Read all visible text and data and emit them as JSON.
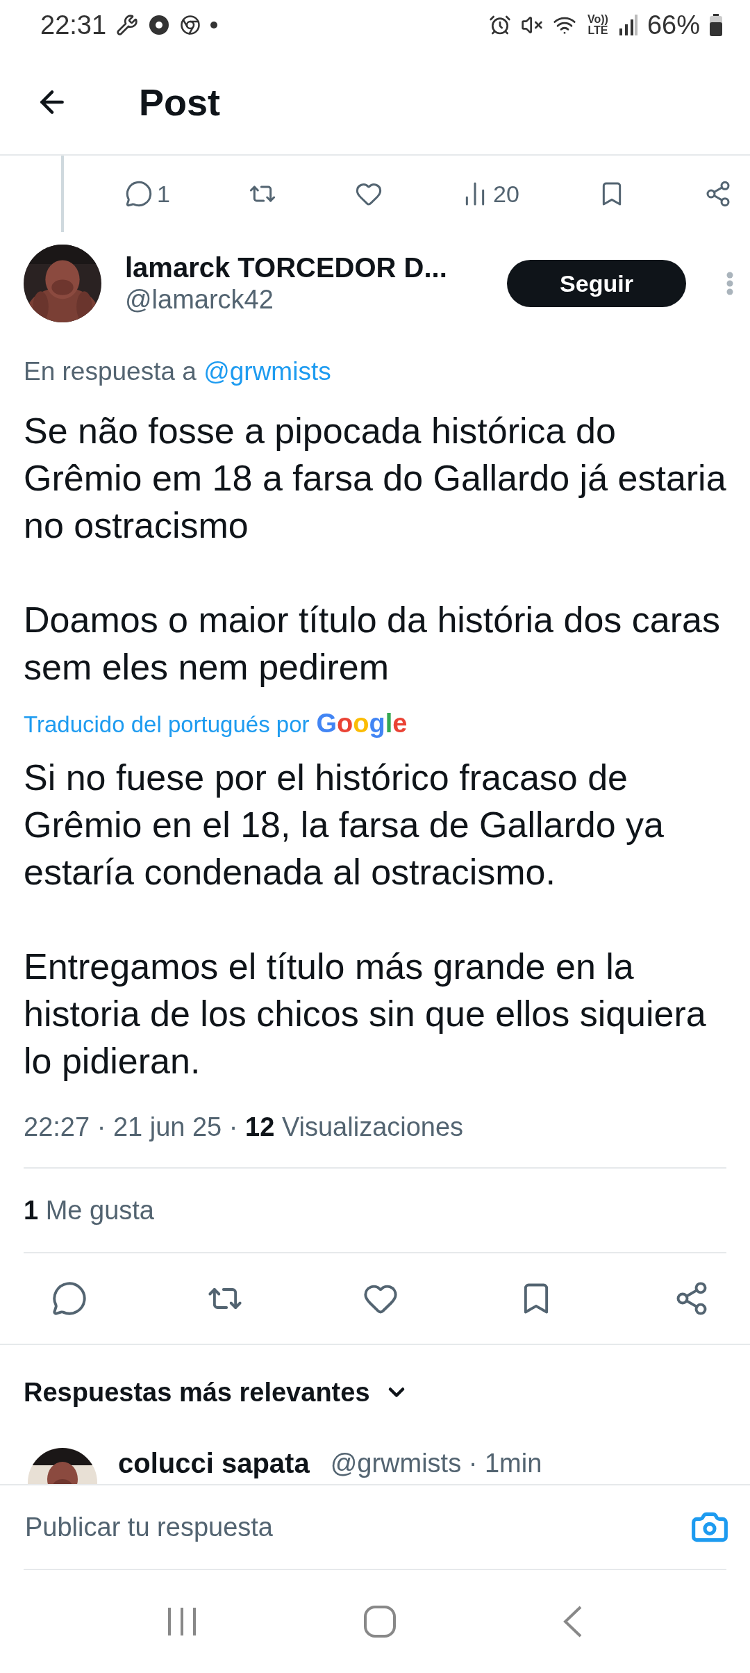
{
  "status_bar": {
    "time": "22:31",
    "network": "Vo)) LTE",
    "battery": "66%"
  },
  "header": {
    "title": "Post"
  },
  "previous_post": {
    "actions": [
      {
        "kind": "reply",
        "count": "1"
      },
      {
        "kind": "repost"
      },
      {
        "kind": "like"
      },
      {
        "kind": "views",
        "count": "20"
      },
      {
        "kind": "bookmark"
      },
      {
        "kind": "share"
      }
    ]
  },
  "post": {
    "author": "lamarck TORCEDOR D...",
    "handle": "@lamarck42",
    "follow_button": "Seguir",
    "reply_to": {
      "prefix": "En respuesta a",
      "mention": "@grwmists"
    },
    "body": [
      "Se não fosse a pipocada histórica do Grêmio em 18 a farsa do Gallardo já estaria no ostracismo",
      "Doamos o maior título da história dos caras sem eles nem pedirem"
    ],
    "translation": {
      "label": "Traducido del portugués por",
      "provider": "Google"
    },
    "translated_body": [
      "Si no fuese por el histórico fracaso de Grêmio en el 18, la farsa de Gallardo ya estaría condenada al ostracismo.",
      "Entregamos el título más grande en la historia de los chicos sin que ellos siquiera lo pidieran."
    ],
    "meta": {
      "time": "22:27",
      "separator": "·",
      "date": "21 jun 25",
      "views_count": "12",
      "views_label": "Visualizaciones"
    },
    "likes": {
      "count": "1",
      "label": "Me gusta"
    },
    "actions": [
      {
        "kind": "reply"
      },
      {
        "kind": "repost"
      },
      {
        "kind": "like"
      },
      {
        "kind": "bookmark"
      },
      {
        "kind": "share"
      }
    ]
  },
  "replies": {
    "title": "Respuestas más relevantes",
    "items": [
      {
        "name": "colucci sapata",
        "handle": "@grwmists",
        "separator": "·",
        "time": "1min"
      }
    ]
  },
  "composer": {
    "placeholder": "Publicar tu respuesta"
  }
}
